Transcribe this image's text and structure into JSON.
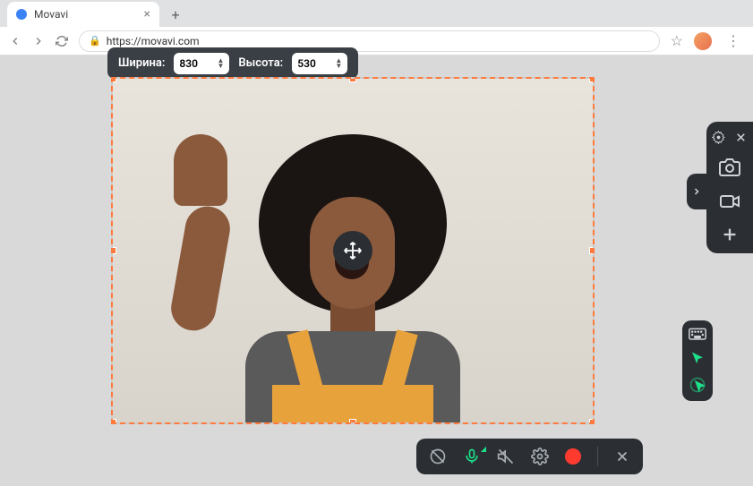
{
  "browser": {
    "tab_title": "Movavi",
    "url": "https://movavi.com"
  },
  "dimensions": {
    "width_label": "Ширина:",
    "width_value": "830",
    "height_label": "Высота:",
    "height_value": "530"
  },
  "colors": {
    "accent_orange": "#ff7a3d",
    "accent_green": "#1de08a",
    "record_red": "#ff3b30",
    "panel_bg": "#2b2f33"
  }
}
